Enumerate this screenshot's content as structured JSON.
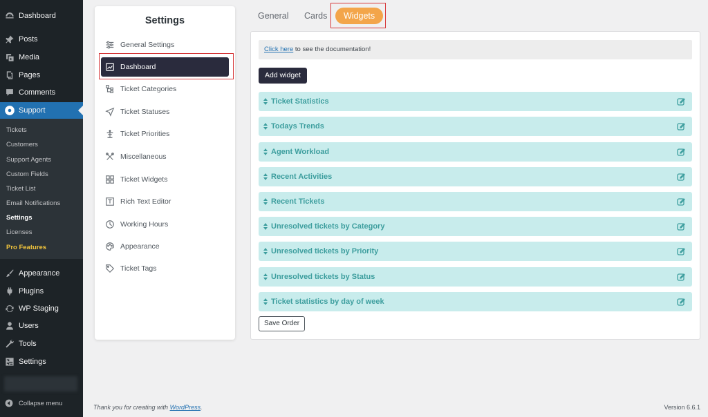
{
  "admin_menu": {
    "top_items": [
      {
        "label": "Dashboard",
        "icon": "dashboard-icon"
      },
      {
        "label": "Posts",
        "icon": "pin-icon"
      },
      {
        "label": "Media",
        "icon": "media-icon"
      },
      {
        "label": "Pages",
        "icon": "pages-icon"
      },
      {
        "label": "Comments",
        "icon": "comments-icon"
      },
      {
        "label": "Support",
        "icon": "support-icon"
      }
    ],
    "submenu": [
      "Tickets",
      "Customers",
      "Support Agents",
      "Custom Fields",
      "Ticket List",
      "Email Notifications",
      "Settings",
      "Licenses",
      "Pro Features"
    ],
    "bottom_items": [
      {
        "label": "Appearance",
        "icon": "brush-icon"
      },
      {
        "label": "Plugins",
        "icon": "plugin-icon"
      },
      {
        "label": "WP Staging",
        "icon": "sync-icon"
      },
      {
        "label": "Users",
        "icon": "users-icon"
      },
      {
        "label": "Tools",
        "icon": "wrench-icon"
      },
      {
        "label": "Settings",
        "icon": "settings-icon"
      }
    ],
    "collapse_label": "Collapse menu"
  },
  "settings_panel": {
    "title": "Settings",
    "items": [
      {
        "label": "General Settings",
        "icon": "sliders-icon"
      },
      {
        "label": "Dashboard",
        "icon": "chart-icon"
      },
      {
        "label": "Ticket Categories",
        "icon": "hierarchy-icon"
      },
      {
        "label": "Ticket Statuses",
        "icon": "send-icon"
      },
      {
        "label": "Ticket Priorities",
        "icon": "priority-icon"
      },
      {
        "label": "Miscellaneous",
        "icon": "tools-icon"
      },
      {
        "label": "Ticket Widgets",
        "icon": "widgets-icon"
      },
      {
        "label": "Rich Text Editor",
        "icon": "editor-icon"
      },
      {
        "label": "Working Hours",
        "icon": "clock-icon"
      },
      {
        "label": "Appearance",
        "icon": "palette-icon"
      },
      {
        "label": "Ticket Tags",
        "icon": "tag-icon"
      }
    ]
  },
  "tabs": [
    "General",
    "Cards",
    "Widgets"
  ],
  "content": {
    "doc_link": "Click here",
    "doc_text": " to see the documentation!",
    "add_widget_label": "Add widget",
    "widgets": [
      "Ticket Statistics",
      "Todays Trends",
      "Agent Workload",
      "Recent Activities",
      "Recent Tickets",
      "Unresolved tickets by Category",
      "Unresolved tickets by Priority",
      "Unresolved tickets by Status",
      "Ticket statistics by day of week"
    ],
    "save_order_label": "Save Order"
  },
  "footer": {
    "thanks_prefix": "Thank you for creating with ",
    "thanks_link": "WordPress",
    "thanks_suffix": ".",
    "version": "Version 6.6.1"
  },
  "colors": {
    "admin_bg": "#1d2327",
    "admin_active": "#2271b1",
    "accent_orange": "#f3a54a",
    "nav_active": "#2a2b3d",
    "widget_bg": "#c8ecec",
    "widget_text": "#3d9e9e",
    "highlight": "#d63638"
  }
}
